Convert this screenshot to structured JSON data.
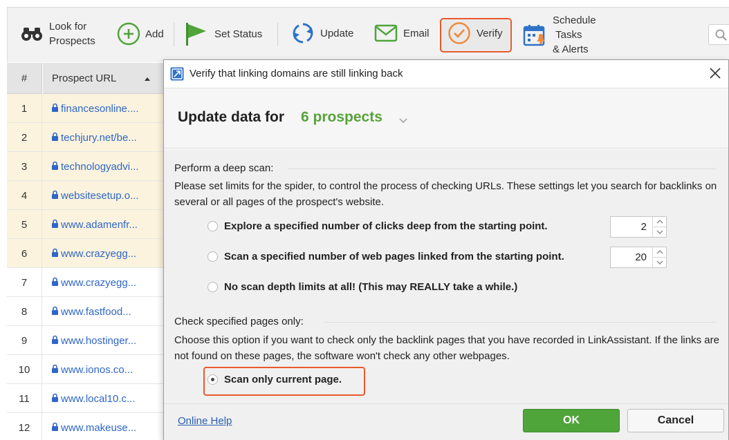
{
  "toolbar": {
    "look_label_1": "Look for",
    "look_label_2": "Prospects",
    "add_label": "Add",
    "set_status_label": "Set Status",
    "update_label": "Update",
    "email_label": "Email",
    "verify_label": "Verify",
    "schedule_label_1": "Schedule",
    "schedule_label_2": "Tasks",
    "schedule_label_3": "& Alerts"
  },
  "table": {
    "col_num": "#",
    "col_url": "Prospect URL",
    "rows": [
      {
        "num": "1",
        "url": "financesonline...."
      },
      {
        "num": "2",
        "url": "techjury.net/be..."
      },
      {
        "num": "3",
        "url": "technologyadvi..."
      },
      {
        "num": "4",
        "url": "websitesetup.o..."
      },
      {
        "num": "5",
        "url": "www.adamenfr..."
      },
      {
        "num": "6",
        "url": "www.crazyegg..."
      },
      {
        "num": "7",
        "url": "www.crazyegg..."
      },
      {
        "num": "8",
        "url": "www.fastfood..."
      },
      {
        "num": "9",
        "url": "www.hostinger..."
      },
      {
        "num": "10",
        "url": "www.ionos.co..."
      },
      {
        "num": "11",
        "url": "www.local10.c..."
      },
      {
        "num": "12",
        "url": "www.makeuse..."
      }
    ]
  },
  "dialog": {
    "title": "Verify that linking domains are still linking back",
    "header_text": "Update data for",
    "header_count": "6 prospects",
    "deep_scan_title": "Perform a deep scan:",
    "deep_scan_desc": "Please set limits for the spider, to control the process of checking URLs. These settings let you search for backlinks on several or all pages of the prospect's website.",
    "option_clicks": "Explore a specified number of clicks deep from the starting point.",
    "option_clicks_value": "2",
    "option_pages": "Scan a specified number of web pages linked from the starting point.",
    "option_pages_value": "20",
    "option_nolimit": "No scan depth limits at all! (This may REALLY take a while.)",
    "check_title": "Check specified pages only:",
    "check_desc": "Choose this option if you want to check only the backlink pages that you have recorded in LinkAssistant. If the links are not found on these pages, the software won't check any other webpages.",
    "option_current": "Scan only current page.",
    "help_link": "Online Help",
    "ok_label": "OK",
    "cancel_label": "Cancel"
  },
  "colors": {
    "accent_green": "#4fa43a",
    "highlight_orange": "#e85a2c",
    "link_blue": "#2f66c8",
    "selected_row": "#fbf3dd"
  }
}
